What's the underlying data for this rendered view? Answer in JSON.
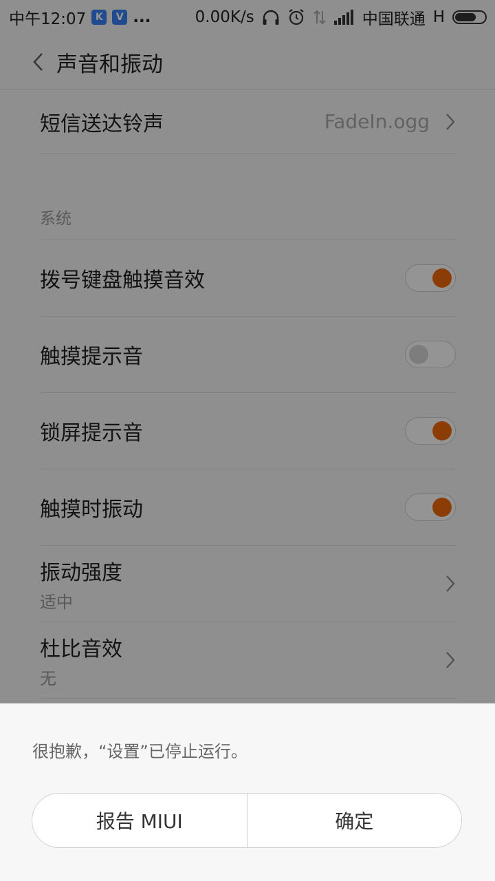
{
  "status_bar": {
    "time": "中午12:07",
    "badge_k": "K",
    "badge_v": "V",
    "more": "...",
    "net_speed": "0.00K/s",
    "carrier": "中国联通",
    "network_type": "H"
  },
  "header": {
    "title": "声音和振动"
  },
  "rows": {
    "sms_tone": {
      "label": "短信送达铃声",
      "value": "FadeIn.ogg"
    },
    "section_system": "系统",
    "dial_pad": {
      "label": "拨号键盘触摸音效",
      "on": true
    },
    "touch_sound": {
      "label": "触摸提示音",
      "on": false
    },
    "lock_sound": {
      "label": "锁屏提示音",
      "on": true
    },
    "touch_vibrate": {
      "label": "触摸时振动",
      "on": true
    },
    "vibrate_strength": {
      "label": "振动强度",
      "sub": "适中"
    },
    "dolby": {
      "label": "杜比音效",
      "sub": "无"
    }
  },
  "dialog": {
    "message": "很抱歉，“设置”已停止运行。",
    "report_label": "报告 MIUI",
    "ok_label": "确定"
  },
  "colors": {
    "toggle_on": "#f26a0c",
    "toggle_off": "#d7d7d7",
    "overlay": "rgba(0,0,0,0.42)"
  }
}
